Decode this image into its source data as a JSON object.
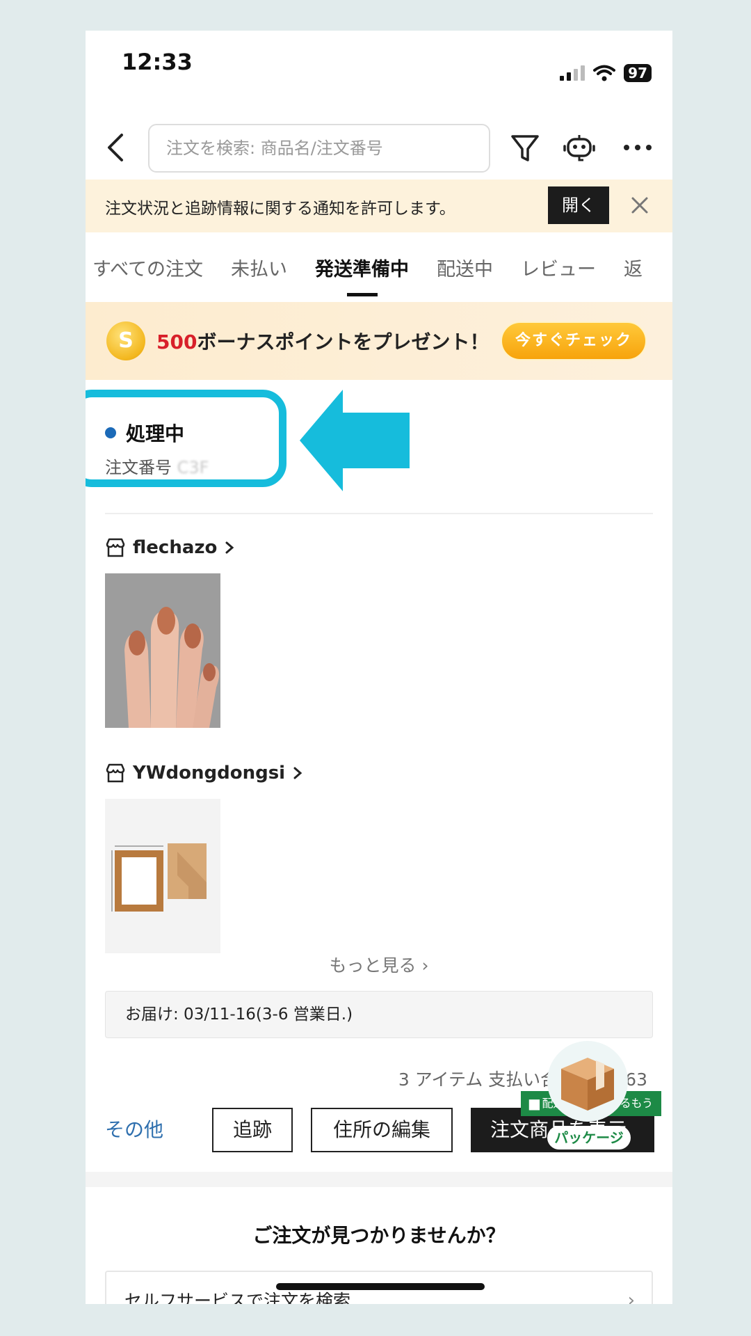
{
  "status_bar": {
    "time": "12:33",
    "battery": "97"
  },
  "header": {
    "search_placeholder": "注文を検索: 商品名/注文番号"
  },
  "notice": {
    "text": "注文状況と追跡情報に関する通知を許可します。",
    "open_label": "開く"
  },
  "tabs": [
    {
      "label": "すべての注文",
      "active": false
    },
    {
      "label": "未払い",
      "active": false
    },
    {
      "label": "発送準備中",
      "active": true
    },
    {
      "label": "配送中",
      "active": false
    },
    {
      "label": "レビュー",
      "active": false
    },
    {
      "label": "返",
      "active": false
    }
  ],
  "promo": {
    "coin_symbol": "S",
    "points": "500",
    "text": "ボーナスポイントをプレゼント！",
    "button_label": "今すぐチェック"
  },
  "order": {
    "status": "処理中",
    "status_color": "#1b6ab8",
    "order_no_label": "注文番号",
    "order_no_value": "C3F",
    "stores": [
      {
        "name": "flechazo"
      },
      {
        "name": "YWdongdongsi"
      }
    ],
    "more_label": "もっと見る",
    "delivery": "お届け: 03/11-16(3-6 営業日.)",
    "summary": "3 アイテム 支払い合計: ¥2,163"
  },
  "actions": {
    "other": "その他",
    "track": "追跡",
    "edit_address": "住所の編集",
    "order_items": "注文商品を表示"
  },
  "package_badge": {
    "ribbon": "配送状況がわかるもう",
    "label": "パッケージ"
  },
  "help": {
    "title": "ご注文が見つかりませんか？",
    "row_label": "セルフサービスで注文を検索"
  },
  "colors": {
    "highlight": "#16bcdc",
    "accent_link": "#2e6fae",
    "promo_red": "#d8202a",
    "notice_bg": "#fdf2dc"
  }
}
